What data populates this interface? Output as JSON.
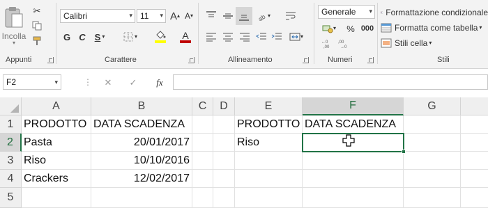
{
  "ribbon": {
    "clipboard": {
      "paste_label": "Incolla",
      "group_label": "Appunti"
    },
    "font": {
      "name": "Calibri",
      "size": "11",
      "bold": "G",
      "italic": "C",
      "underline": "S",
      "grow": "A",
      "shrink": "A",
      "font_color_glyph": "A",
      "group_label": "Carattere"
    },
    "alignment": {
      "group_label": "Allineamento"
    },
    "number": {
      "format": "Generale",
      "percent": "%",
      "thousands": "000",
      "group_label": "Numeri"
    },
    "styles": {
      "conditional": "Formattazione condizionale",
      "as_table": "Formatta come tabella",
      "cell_styles": "Stili cella",
      "group_label": "Stili"
    }
  },
  "formula_bar": {
    "name_box": "F2",
    "fx": "fx",
    "value": ""
  },
  "sheet": {
    "columns": [
      "A",
      "B",
      "C",
      "D",
      "E",
      "F",
      "G"
    ],
    "rows": [
      "1",
      "2",
      "3",
      "4",
      "5"
    ],
    "selected_cell": "F2",
    "cells": {
      "A1": "PRODOTTO",
      "B1": "DATA SCADENZA",
      "A2": "Pasta",
      "B2": "20/01/2017",
      "A3": "Riso",
      "B3": "10/10/2016",
      "A4": "Crackers",
      "B4": "12/02/2017",
      "E1": "PRODOTTO",
      "F1": "DATA SCADENZA",
      "E2": "Riso"
    }
  },
  "colors": {
    "accent": "#217346",
    "font_color_bar": "#c00000",
    "highlight_bar": "#ffff00"
  }
}
